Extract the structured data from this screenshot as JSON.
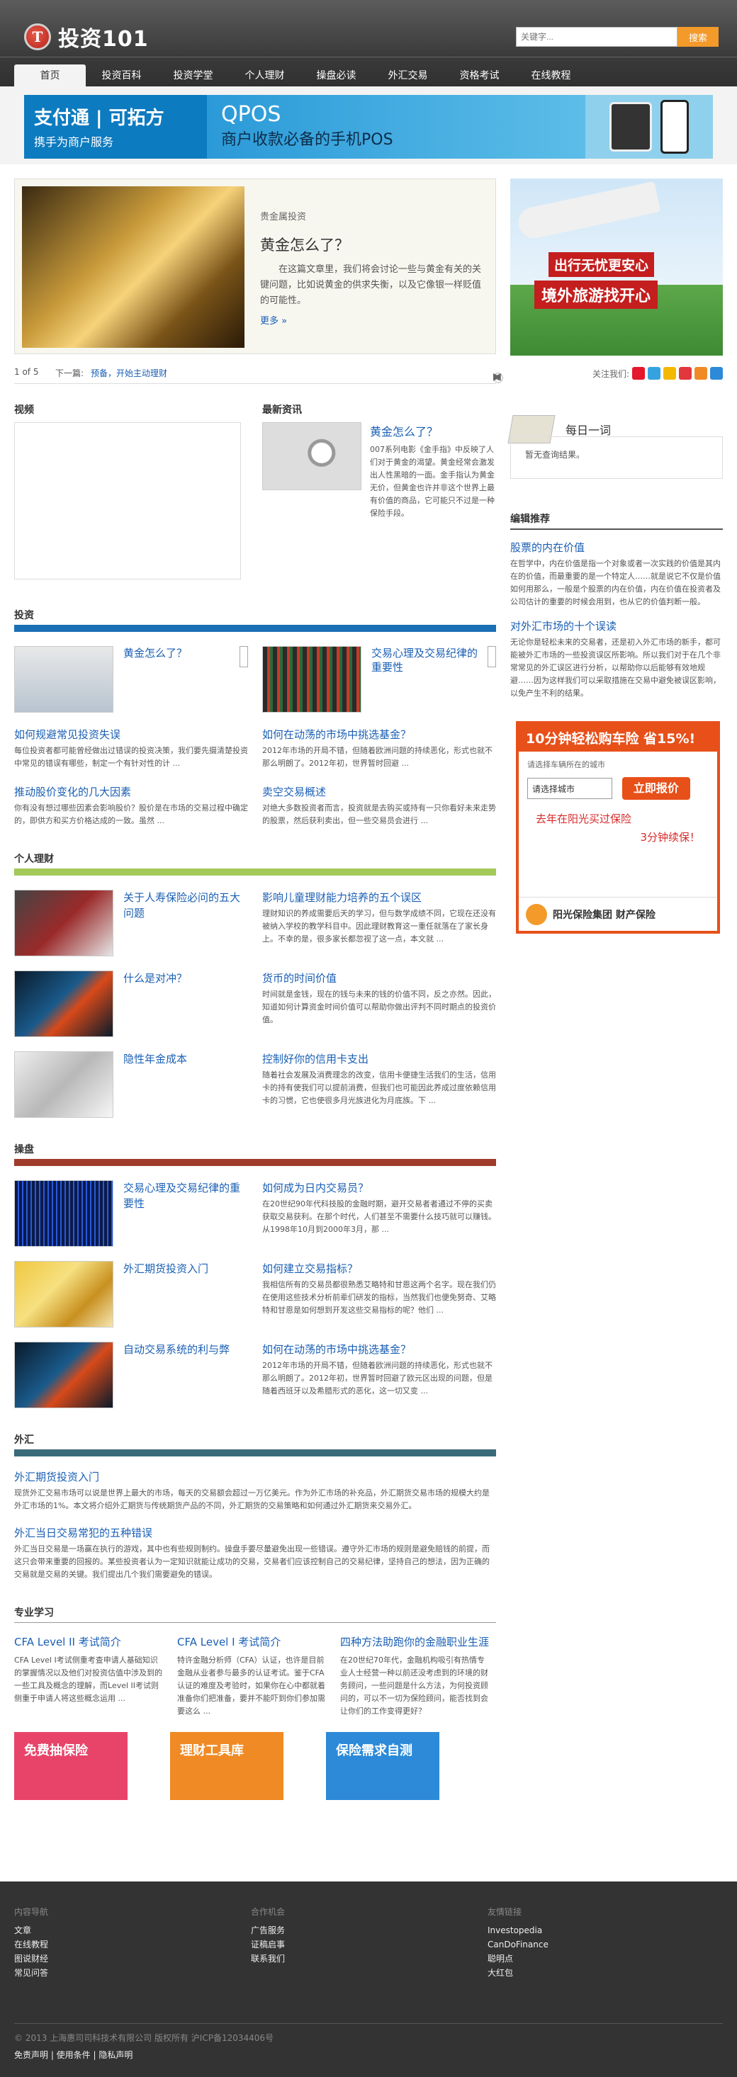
{
  "header": {
    "logo_mark": "T",
    "logo_text": "投资101",
    "search_placeholder": "关键字...",
    "search_button": "搜索"
  },
  "nav": [
    "首页",
    "投资百科",
    "投资学堂",
    "个人理财",
    "操盘必读",
    "外汇交易",
    "资格考试",
    "在线教程"
  ],
  "banner": {
    "left_line1": "支付通 | 可拓方",
    "left_line2": "携手为商户服务",
    "mid_line1": "QPOS",
    "mid_line2": "商户收款必备的手机POS"
  },
  "feature": {
    "category": "贵金属投资",
    "title": "黄金怎么了？",
    "desc": "在这篇文章里，我们将会讨论一些与黄金有关的关键问题，比如说黄金的供求失衡，以及它像银一样贬值的可能性。",
    "more": "更多 »"
  },
  "pager": {
    "count": "1 of 5",
    "next_label": "下一篇:",
    "next_links": "预备，开始主动理财"
  },
  "video": {
    "heading": "视频"
  },
  "latest": {
    "heading": "最新资讯",
    "title": "黄金怎么了？",
    "desc": "007系列电影《金手指》中反映了人们对于黄金的渴望。黄金经常会激发出人性黑暗的一面。金手指认为黄金无价，但黄金也许并非这个世界上最有价值的商品，它可能只不过是一种保险手段。"
  },
  "invest": {
    "title": "投资",
    "bar_color": "#1a6fb5",
    "pairs": [
      {
        "title": "黄金怎么了？"
      },
      {
        "title": "交易心理及交易纪律的重要性"
      }
    ],
    "texts": [
      {
        "title": "如何规避常见投资失误",
        "desc": "每位投资者都可能曾经做出过错误的投资决策，我们要先摄清楚投资中常见的错误有哪些，制定一个有针对性的计 ..."
      },
      {
        "title": "如何在动荡的市场中挑选基金？",
        "desc": "2012年市场的开局不错，但随着欧洲问题的持续恶化，形式也就不那么明朗了。2012年初，世界暂时回避 ..."
      },
      {
        "title": "推动股价变化的几大因素",
        "desc": "你有没有想过哪些因素会影响股价？股价是在市场的交易过程中确定的，即供方和买方价格达成的一致。虽然 ..."
      },
      {
        "title": "卖空交易概述",
        "desc": "对绝大多数投资者而言，投资就是去购买或持有一只你看好未来走势的股票，然后获利卖出，但一些交易员会进行 ..."
      }
    ]
  },
  "finance": {
    "title": "个人理财",
    "bar_color": "#a3c95a",
    "rows": [
      {
        "left": "关于人寿保险必问的五大问题",
        "right_title": "影响儿童理财能力培养的五个误区",
        "right_desc": "理财知识的养成需要后天的学习，但与数学成绩不同，它现在还没有被纳入学校的教学科目中。因此理财教育这一重任就落在了家长身上。不幸的是，很多家长都忽视了这一点，本文就 ..."
      },
      {
        "left": "什么是对冲？",
        "right_title": "货币的时间价值",
        "right_desc": "时间就是金钱，现在的钱与未来的钱的价值不同，反之亦然。因此，知道如何计算资金时间价值可以帮助你做出评判不同时期点的投资价值。"
      },
      {
        "left": "隐性年金成本",
        "right_title": "控制好你的信用卡支出",
        "right_desc": "随着社会发展及消费理念的改变，信用卡便捷生活我们的生活，信用卡的持有使我们可以提前消费，但我们也可能因此养成过度依赖信用卡的习惯，它也使很多月光族进化为月底族。下 ..."
      }
    ]
  },
  "trading": {
    "title": "操盘",
    "bar_color": "#9e3b2b",
    "rows": [
      {
        "left": "交易心理及交易纪律的重要性",
        "right_title": "如何成为日内交易员？",
        "right_desc": "在20世纪90年代科技股的金融时期，避开交易者者通过不停的买卖获取交易获利。在那个时代，人们甚至不需要什么技巧就可以赚钱。从1998年10月到2000年3月，那 ..."
      },
      {
        "left": "外汇期货投资入门",
        "right_title": "如何建立交易指标？",
        "right_desc": "我相信所有的交易员都很熟悉艾略特和甘恩这两个名字。现在我们仍在使用这些技术分析前辈们研发的指标，当然我们也便免努奇、艾略特和甘恩是如何想到开发这些交易指标的呢？他们 ..."
      },
      {
        "left": "自动交易系统的利与弊",
        "right_title": "如何在动荡的市场中挑选基金？",
        "right_desc": "2012年市场的开局不错，但随着欧洲问题的持续恶化，形式也就不那么明朗了。2012年初，世界暂时回避了欧元区出现的问题，但是随着西班牙以及希腊形式的恶化，这一切又变 ..."
      }
    ]
  },
  "forex": {
    "title": "外汇",
    "bar_color": "#3a6a7a",
    "items": [
      {
        "title": "外汇期货投资入门",
        "desc": "现货外汇交易市场可以说是世界上最大的市场，每天的交易额会超过一万亿美元。作为外汇市场的补充品，外汇期货交易市场的规模大约是外汇市场的1%。本文将介绍外汇期货与传统期货产品的不同，外汇期货的交易策略和如何通过外汇期货来交易外汇。"
      },
      {
        "title": "外汇当日交易常犯的五种错误",
        "desc": "外汇当日交易是一场赢在执行的游戏，其中也有些规则制约。操盘手要尽量避免出现一些错误。遵守外汇市场的规则是避免赔钱的前提，而这只会带来重要的回报的。某些投资者认为一定知识就能让成功的交易，交易者们应该控制自己的交易纪律，坚持自己的想法，因为正确的交易就是交易的关键。我们提出几个我们需要避免的错误。"
      }
    ]
  },
  "study": {
    "title": "专业学习",
    "items": [
      {
        "title": "CFA Level II 考试简介",
        "desc": "CFA Level I考试侧重考查申请人基础知识的掌握情况以及他们对投资估值中涉及到的一些工具及概念的理解，而Level II考试则侧重于申请人将这些概念运用 ..."
      },
      {
        "title": "CFA Level I 考试简介",
        "desc": "特许金融分析师（CFA）认证，也许是目前金融从业者参与最多的认证考试。鉴于CFA认证的难度及考验时，如果你在心中都就着准备你们把准备，要并不能吓到你们参加需要这么 ..."
      },
      {
        "title": "四种方法助跑你的金融职业生涯",
        "desc": "在20世纪70年代，金融机构吸引有热情专业人士经营一种以前还没考虑到的环境的财务顾问，一些问题是什么方法，为何投资顾问的，可以不一切为保险顾问，能否找到会让你们的工作变得更好？"
      }
    ],
    "tools": [
      {
        "label": "免费抽保险",
        "color": "#e8446a"
      },
      {
        "label": "理财工具库",
        "color": "#f08a24"
      },
      {
        "label": "保险需求自测",
        "color": "#2c8ad8"
      }
    ]
  },
  "sidebar": {
    "ad1_line1": "出行无忧更安心",
    "ad1_line2": "境外旅游找开心",
    "share_label": "关注我们:",
    "share_icons": [
      {
        "name": "weibo-icon",
        "color": "#e6162d"
      },
      {
        "name": "qq-weibo-icon",
        "color": "#35a3e0"
      },
      {
        "name": "qzone-icon",
        "color": "#f5b800"
      },
      {
        "name": "renren-icon",
        "color": "#e2373d"
      },
      {
        "name": "douban-icon",
        "color": "#f08a24"
      },
      {
        "name": "people-icon",
        "color": "#2c8ad8"
      }
    ],
    "daily_heading": "每日一词",
    "daily_empty": "暂无查询结果。",
    "editor_heading": "编辑推荐",
    "editor": [
      {
        "title": "股票的内在价值",
        "desc": "在哲学中，内在价值是指一个对象或者一次实践的价值是其内在的价值，而最重要的是一个特定人……就是说它不仅是价值如何用那么，一般是个股票的内在价值，内在价值在投资者及公司估计的重要的时候会用到，也从它的价值判断一般。"
      },
      {
        "title": "对外汇市场的十个误读",
        "desc": "无论你是轻松未来的交易者，还是初入外汇市场的新手，都可能被外汇市场的一些投资误区所影响。所以我们对于在几个非常常见的外汇误区进行分析，以帮助你以后能够有效地规避……因为这样我们可以采取措施在交易中避免被误区影响，以免产生不利的结果。"
      }
    ],
    "ad2": {
      "headline": "10分钟轻松购车险 省15%!",
      "prompt": "请选择车辆所在的城市",
      "select": "请选择城市",
      "button": "立即报价",
      "slogan1": "去年在阳光买过保险",
      "slogan2": "3分钟续保！",
      "brand": "阳光保险集团 财产保险"
    }
  },
  "footer": {
    "col1_head": "内容导航",
    "col1": [
      "文章",
      "在线教程",
      "图说财经",
      "常见问答"
    ],
    "col2_head": "合作机会",
    "col2": [
      "广告服务",
      "证稿启事",
      "联系我们"
    ],
    "col3_head": "友情链接",
    "col3": [
      "Investopedia",
      "CanDoFinance",
      "聪明点",
      "大红包"
    ],
    "copyright": "© 2013 上海惠司司科技术有限公司 版权所有 沪ICP备12034406号",
    "links2": "免责声明 | 使用条件 | 隐私声明"
  }
}
